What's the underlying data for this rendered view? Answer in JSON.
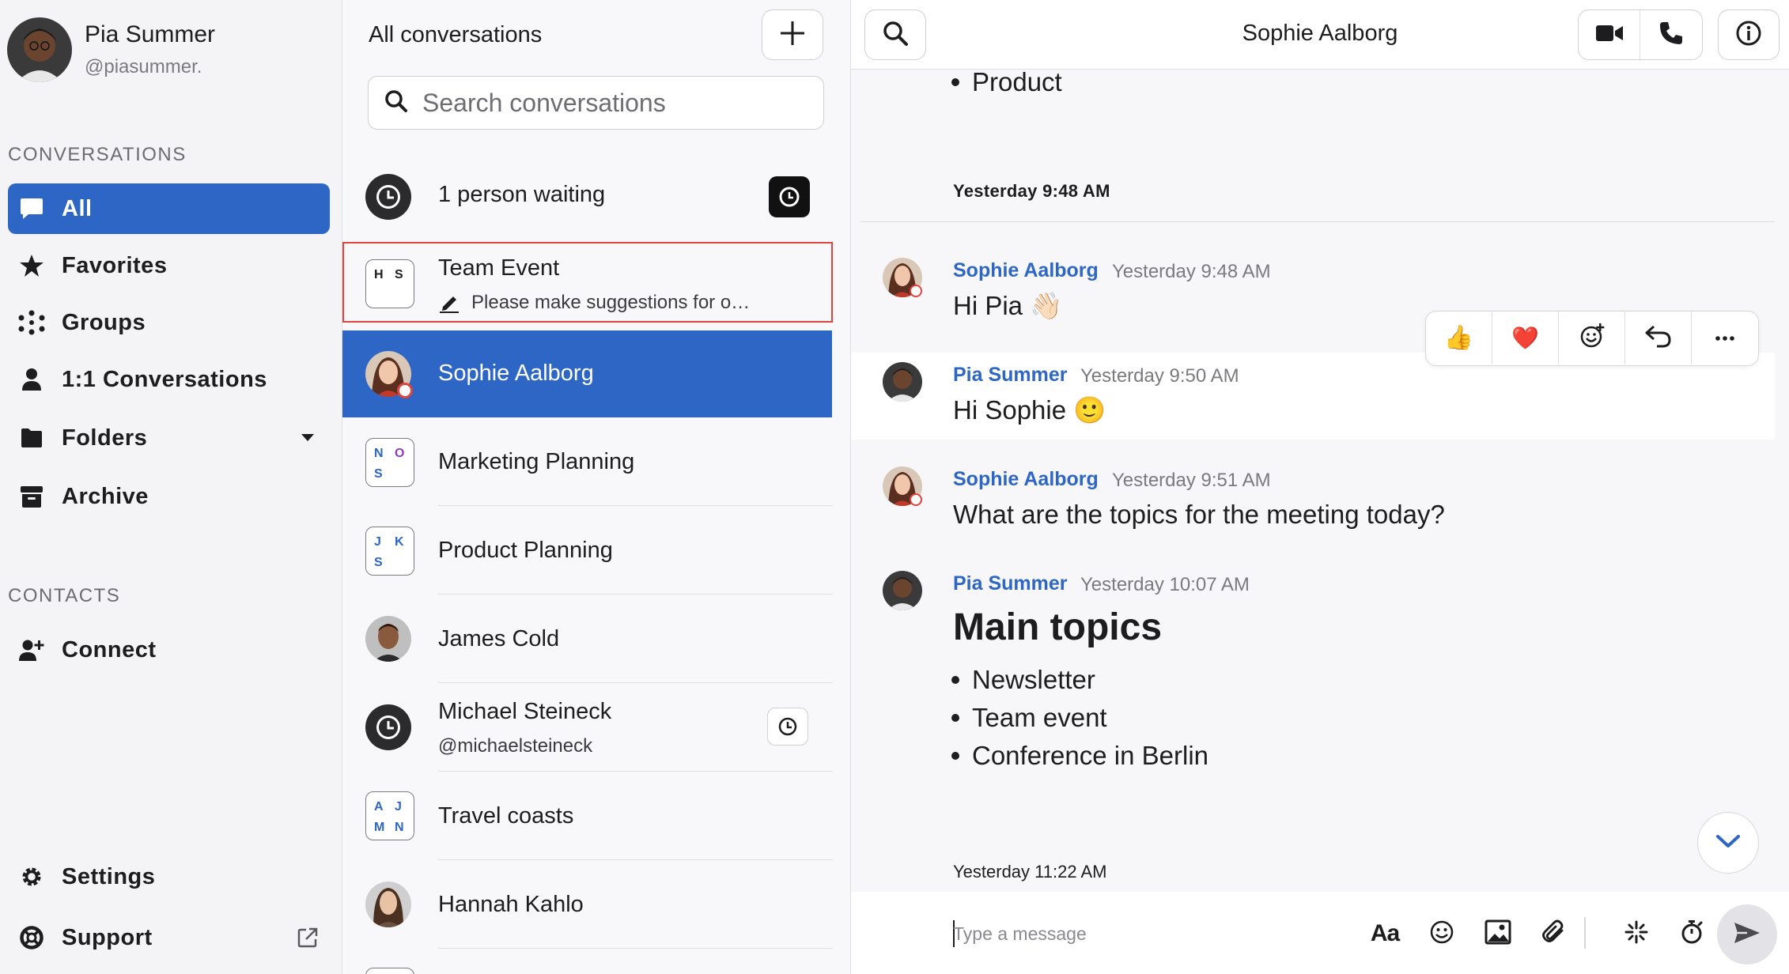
{
  "user": {
    "name": "Pia Summer",
    "handle": "@piasummer."
  },
  "sidebar": {
    "conversations_label": "CONVERSATIONS",
    "items": [
      {
        "label": "All",
        "icon": "chat-bubble-icon",
        "active": true
      },
      {
        "label": "Favorites",
        "icon": "star-icon"
      },
      {
        "label": "Groups",
        "icon": "groups-dots-icon"
      },
      {
        "label": "1:1 Conversations",
        "icon": "person-icon"
      },
      {
        "label": "Folders",
        "icon": "folder-icon"
      },
      {
        "label": "Archive",
        "icon": "archive-icon"
      }
    ],
    "contacts_label": "CONTACTS",
    "contacts": [
      {
        "label": "Connect",
        "icon": "add-person-icon"
      }
    ],
    "bottom": [
      {
        "label": "Settings",
        "icon": "gear-icon"
      },
      {
        "label": "Support",
        "icon": "lifebuoy-icon"
      }
    ]
  },
  "conversations": {
    "title": "All conversations",
    "search_placeholder": "Search conversations",
    "items": [
      {
        "title": "1 person waiting",
        "type": "waiting"
      },
      {
        "title": "Team Event",
        "subtitle": "Please make suggestions for o…",
        "initials": [
          "H",
          "S"
        ],
        "initial_colors": [
          "#2d66c4",
          "#2d66c4"
        ]
      },
      {
        "title": "Sophie Aalborg",
        "type": "person",
        "selected": true
      },
      {
        "title": "Marketing Planning",
        "initials": [
          "N",
          "O",
          "S"
        ],
        "initial_colors": [
          "#2d66c4",
          "#8a3fbf",
          "#2d66c4"
        ]
      },
      {
        "title": "Product Planning",
        "initials": [
          "J",
          "K",
          "S"
        ],
        "initial_colors": [
          "#2d66c4",
          "#2d66c4",
          "#2d66c4"
        ]
      },
      {
        "title": "James Cold",
        "type": "person"
      },
      {
        "title": "Michael Steineck",
        "subtitle": "@michaelsteineck",
        "type": "waiting"
      },
      {
        "title": "Travel coasts",
        "initials": [
          "A",
          "J",
          "M",
          "N"
        ],
        "initial_colors": [
          "#2d66c4",
          "#2d66c4",
          "#2d66c4",
          "#2d66c4"
        ]
      },
      {
        "title": "Hannah Kahlo",
        "type": "person"
      }
    ]
  },
  "chat": {
    "title": "Sophie Aalborg",
    "top_bullet": "Product",
    "day_separator": "Yesterday 9:48 AM",
    "messages": [
      {
        "author": "Sophie Aalborg",
        "time": "Yesterday 9:48 AM",
        "text": "Hi Pia 👋🏻"
      },
      {
        "author": "Pia Summer",
        "time": "Yesterday 9:50 AM",
        "text": "Hi Sophie 🙂"
      },
      {
        "author": "Sophie Aalborg",
        "time": "Yesterday 9:51 AM",
        "text": "What are the topics for the meeting today?"
      },
      {
        "author": "Pia Summer",
        "time": "Yesterday 10:07 AM",
        "heading": "Main topics",
        "bullets": [
          "Newsletter",
          "Team event",
          "Conference in Berlin"
        ]
      }
    ],
    "reactions": [
      "👍",
      "❤️"
    ],
    "last_timestamp": "Yesterday 11:22 AM",
    "composer_placeholder": "Type a message",
    "format_label": "Aa"
  },
  "colors": {
    "accent": "#2d66c4",
    "highlight_border": "#e0443e",
    "status_red": "#e0443e"
  }
}
